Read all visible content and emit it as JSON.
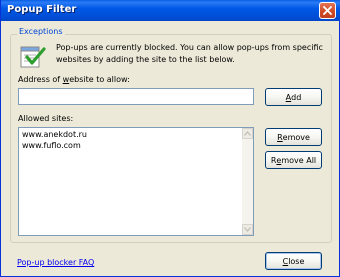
{
  "window": {
    "title": "Popup Filter",
    "close_icon": "close-icon"
  },
  "exceptions": {
    "legend": "Exceptions",
    "icon": "checklist-icon",
    "info_line_1": "Pop-ups are currently blocked. You can allow pop-ups from specific",
    "info_line_2": "websites by adding the site to the list below."
  },
  "address": {
    "label_pre": "Address of ",
    "label_accel": "w",
    "label_post": "ebsite to allow:",
    "value": ""
  },
  "add_button": {
    "accel": "A",
    "rest": "dd"
  },
  "allowed": {
    "label": "Allowed sites:",
    "items": [
      "www.anekdot.ru",
      "www.fuflo.com"
    ]
  },
  "remove_button": {
    "accel": "R",
    "rest": "emove"
  },
  "remove_all_button": {
    "pre": "R",
    "accel": "e",
    "rest": "move All"
  },
  "faq_link": "Pop-up blocker FAQ",
  "close_button": {
    "accel": "C",
    "rest": "lose"
  },
  "colors": {
    "titlebar": "#0058E6",
    "legend": "#0046D5",
    "link": "#0000EE",
    "dialog_bg": "#ECE9D8"
  }
}
